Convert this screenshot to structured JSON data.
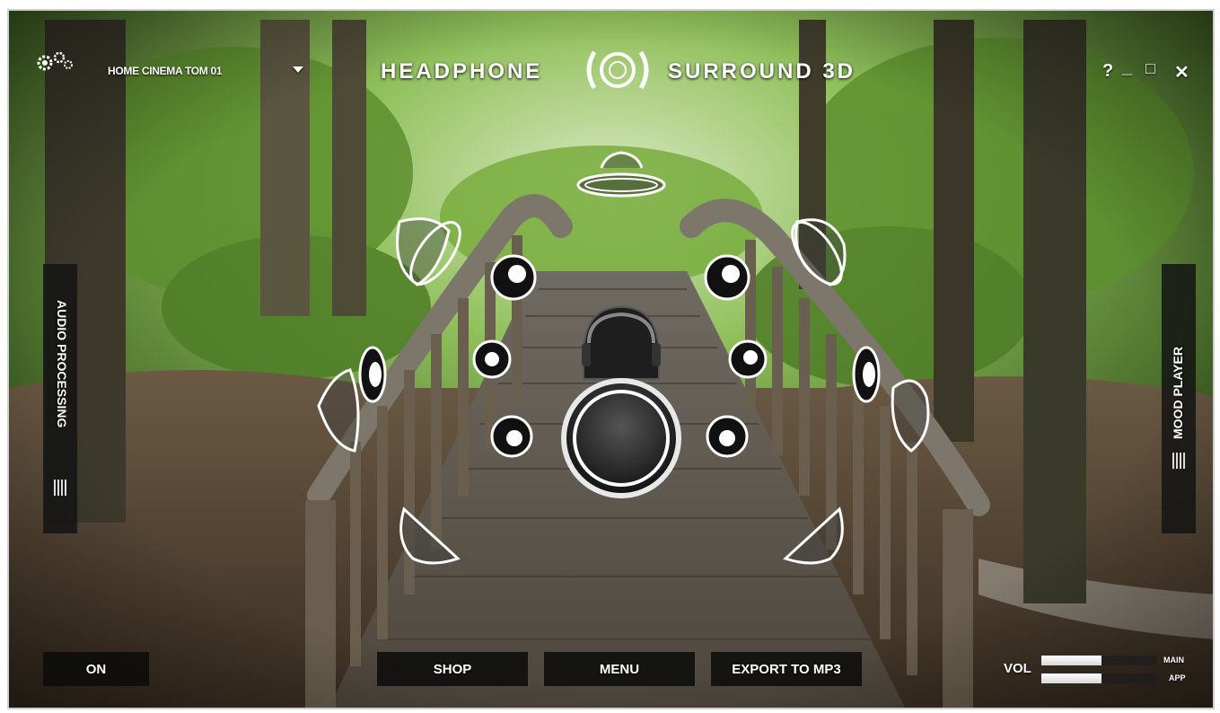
{
  "window": {
    "title_left": "HEADPHONE",
    "title_right": "SURROUND 3D",
    "help": "?",
    "minimize": "_",
    "maximize": "□",
    "close": "✕"
  },
  "preset": {
    "selected": "HOME CINEMA TOM 01"
  },
  "icons": {
    "settings": "gears-icon",
    "logo": "surround-logo-icon",
    "dropdown": "chevron-down-icon",
    "listener": "headphone-listener-icon",
    "speaker": "speaker-icon"
  },
  "side_panels": {
    "left": "AUDIO PROCESSING",
    "right": "MOOD PLAYER"
  },
  "buttons": {
    "on": "ON",
    "shop": "SHOP",
    "menu": "MENU",
    "export": "EXPORT TO MP3"
  },
  "volume": {
    "label": "VOL",
    "main_label": "MAIN",
    "app_label": "APP",
    "main_level": 0.52,
    "app_level": 0.52
  },
  "colors": {
    "foliage": "#4f7a2e",
    "panel": "#141414",
    "text": "#ffffff"
  }
}
